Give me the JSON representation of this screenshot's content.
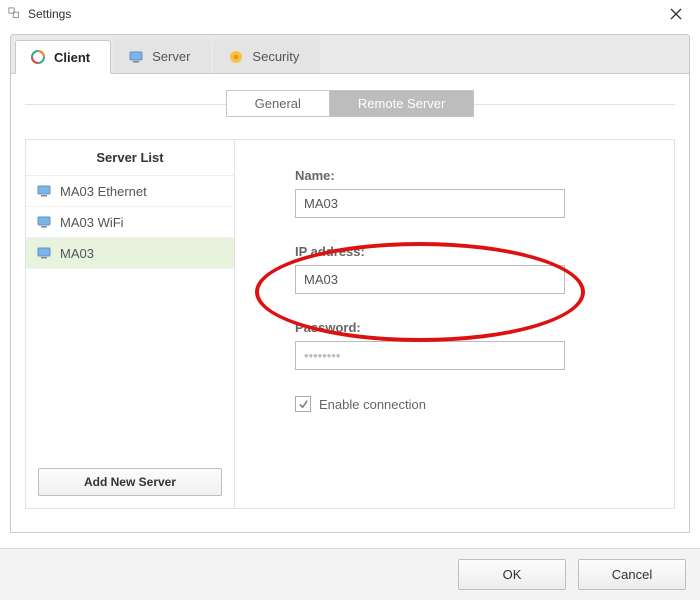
{
  "window": {
    "title": "Settings"
  },
  "tabs": {
    "client": "Client",
    "server": "Server",
    "security": "Security",
    "active": "client"
  },
  "subtabs": {
    "general": "General",
    "remote_server": "Remote Server",
    "active": "remote_server"
  },
  "server_list": {
    "header": "Server List",
    "items": [
      {
        "label": "MA03 Ethernet",
        "selected": false
      },
      {
        "label": "MA03 WiFi",
        "selected": false
      },
      {
        "label": "MA03",
        "selected": true
      }
    ],
    "add_button": "Add New Server"
  },
  "form": {
    "name_label": "Name:",
    "name_value": "MA03",
    "ip_label": "IP address:",
    "ip_value": "MA03",
    "password_label": "Password:",
    "password_value": "••••••••",
    "enable_label": "Enable connection",
    "enable_checked": true
  },
  "dialog": {
    "ok": "OK",
    "cancel": "Cancel"
  },
  "annotation": {
    "highlight": "ip_address_field"
  }
}
